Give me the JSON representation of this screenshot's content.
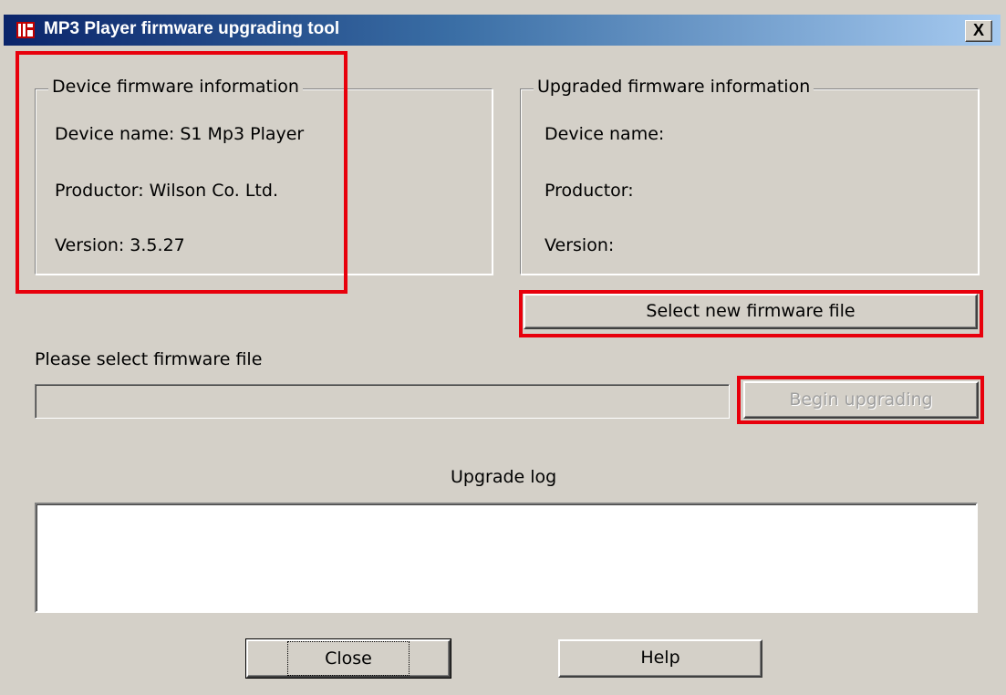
{
  "window": {
    "title": "MP3 Player firmware upgrading tool",
    "app_icon": "app-icon",
    "close_glyph": "X"
  },
  "device_info": {
    "legend": "Device firmware information",
    "device_name": "Device name: S1 Mp3 Player",
    "productor": "Productor: Wilson Co. Ltd.",
    "version": "Version: 3.5.27"
  },
  "upgraded_info": {
    "legend": "Upgraded firmware information",
    "device_name": "Device name:",
    "productor": "Productor:",
    "version": "Version:"
  },
  "select_button": {
    "label": "Select new firmware file"
  },
  "file_prompt": {
    "label": "Please select firmware file",
    "value": ""
  },
  "begin_button": {
    "label": "Begin upgrading",
    "enabled": false
  },
  "log": {
    "label": "Upgrade log",
    "content": ""
  },
  "footer": {
    "close_label": "Close",
    "help_label": "Help"
  },
  "colors": {
    "face": "#d4d0c8",
    "title_start": "#0a246a",
    "title_end": "#a6caf0",
    "annotation": "#e8000c"
  }
}
